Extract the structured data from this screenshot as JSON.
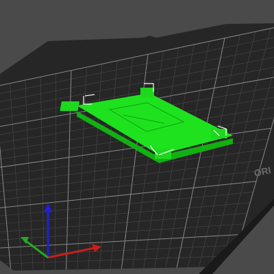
{
  "viewport": {
    "background_color": "#4a4a4a",
    "bed_color": "#262626",
    "bed_edge_color": "#3a3a3a",
    "grid_minor_color": "#4a4a4a",
    "grid_major_color": "#8a8a8a",
    "model_color": "#1ee21e",
    "model_dark_color": "#12b012",
    "selection_color": "#ffffff",
    "bed_label": "ORI",
    "model_name": "",
    "axes": {
      "x_color": "#c81e1e",
      "y_color": "#22aa22",
      "z_color": "#2020d8"
    }
  }
}
